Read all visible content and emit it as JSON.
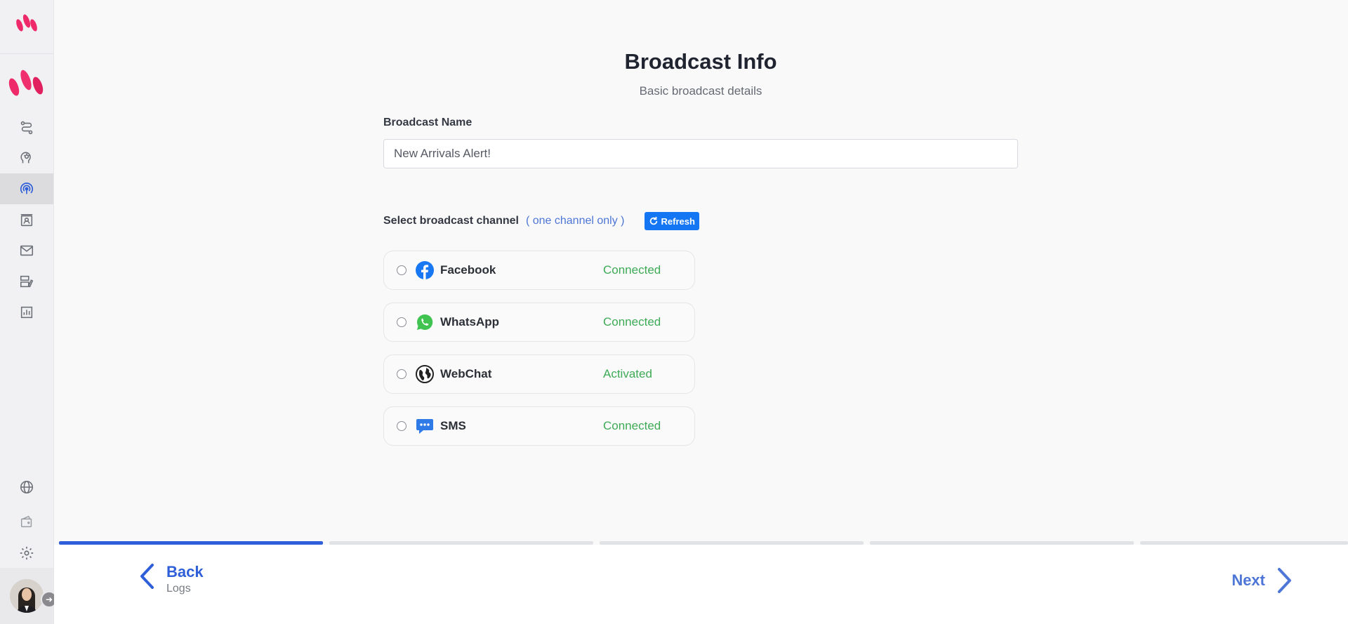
{
  "page": {
    "title": "Broadcast Info",
    "subtitle": "Basic broadcast details"
  },
  "form": {
    "name_label": "Broadcast Name",
    "name_value": "New Arrivals Alert!",
    "channel_label": "Select broadcast channel",
    "channel_hint": "( one channel only )",
    "refresh_label": "Refresh"
  },
  "channels": [
    {
      "name": "Facebook",
      "status": "Connected",
      "icon": "facebook-icon"
    },
    {
      "name": "WhatsApp",
      "status": "Connected",
      "icon": "whatsapp-icon"
    },
    {
      "name": "WebChat",
      "status": "Activated",
      "icon": "globe-icon"
    },
    {
      "name": "SMS",
      "status": "Connected",
      "icon": "sms-chat-icon"
    }
  ],
  "sidebar": {
    "items": [
      {
        "icon": "flow-route-icon"
      },
      {
        "icon": "bot-brain-icon"
      },
      {
        "icon": "broadcast-icon",
        "active": true
      },
      {
        "icon": "contacts-icon"
      },
      {
        "icon": "mail-icon"
      },
      {
        "icon": "templates-icon"
      },
      {
        "icon": "analytics-icon"
      }
    ],
    "bottom_items": [
      {
        "icon": "globe-icon"
      },
      {
        "icon": "wallet-icon"
      },
      {
        "icon": "gear-icon"
      }
    ]
  },
  "progress": {
    "steps": 5,
    "current": 1
  },
  "footer": {
    "back_label": "Back",
    "back_sub": "Logs",
    "next_label": "Next"
  },
  "colors": {
    "brand": "#ee2a6b",
    "accent": "#2f5fd8",
    "status": "#3eaa55",
    "refresh": "#1476f2"
  }
}
